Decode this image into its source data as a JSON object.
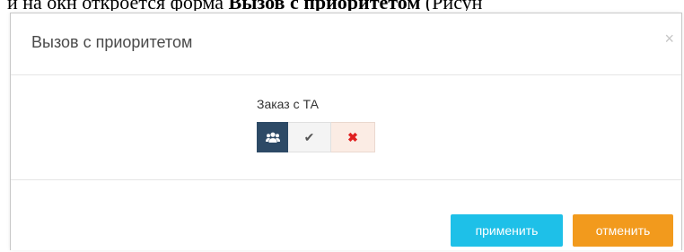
{
  "doc": {
    "prefix": "и на окн откроется форма ",
    "bold": "Вызов с приоритетом",
    "suffix": " (Рисун"
  },
  "dialog": {
    "title": "Вызов с приоритетом",
    "close_glyph": "×"
  },
  "field": {
    "label": "Заказ с ТА",
    "options": [
      {
        "icon": "group-icon",
        "glyph": "👥",
        "selected": true
      },
      {
        "icon": "check-icon",
        "glyph": "✔",
        "selected": false
      },
      {
        "icon": "cross-icon",
        "glyph": "✖",
        "selected": false
      }
    ]
  },
  "footer": {
    "apply_label": "применить",
    "cancel_label": "отменить"
  },
  "colors": {
    "apply": "#1ec0e8",
    "cancel": "#f29a1d",
    "selected": "#2d4a66",
    "cross": "#e02020"
  }
}
